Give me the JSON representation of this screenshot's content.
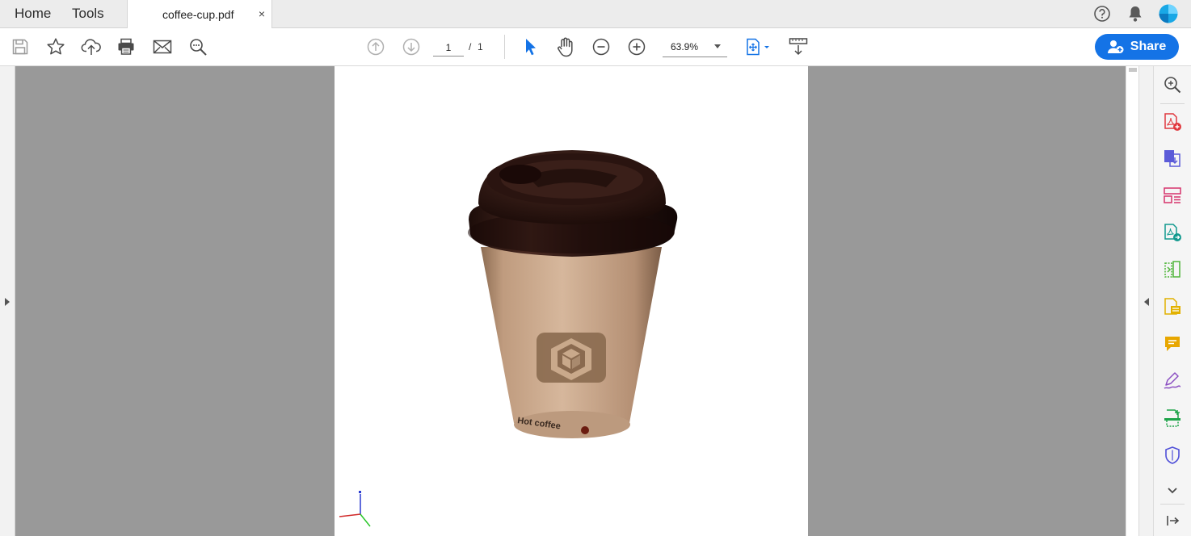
{
  "tabs": {
    "home_label": "Home",
    "tools_label": "Tools",
    "document_tab": "coffee-cup.pdf",
    "close_glyph": "×"
  },
  "top_right_icons": [
    "help-icon",
    "notification-bell-icon",
    "account-avatar-icon"
  ],
  "toolbar": {
    "left_icons": [
      "save-icon",
      "bookmark-star-icon",
      "upload-cloud-icon",
      "print-icon",
      "email-icon",
      "search-zoom-icon"
    ],
    "nav_icons": [
      "previous-page-icon",
      "next-page-icon"
    ],
    "page_current": "1",
    "page_separator": "/",
    "page_total": "1",
    "mode_icons": [
      "select-cursor-icon",
      "hand-pan-icon",
      "zoom-out-icon",
      "zoom-in-icon"
    ],
    "zoom_value": "63.9%",
    "view_icons": [
      "fit-page-icon",
      "scrolling-mode-icon"
    ],
    "share_label": "Share"
  },
  "document": {
    "print_text": "Hot coffee",
    "scene": "3D coffee cup model with brown lid and kraft paper sleeve"
  },
  "right_tools": [
    "zoom-search-icon",
    "create-pdf-icon",
    "export-pdf-icon",
    "organize-pages-icon",
    "combine-files-icon",
    "compare-files-icon",
    "edit-pdf-icon",
    "comment-icon",
    "fill-sign-icon",
    "scan-ocr-icon",
    "protect-icon",
    "more-tools-chevron-icon",
    "collapse-panel-icon"
  ],
  "colors": {
    "accent": "#1473e6",
    "canvas_gray": "#999999",
    "avatar": "#19a8e6",
    "cup_kraft": "#c49e80",
    "cup_lid": "#2b1612"
  }
}
